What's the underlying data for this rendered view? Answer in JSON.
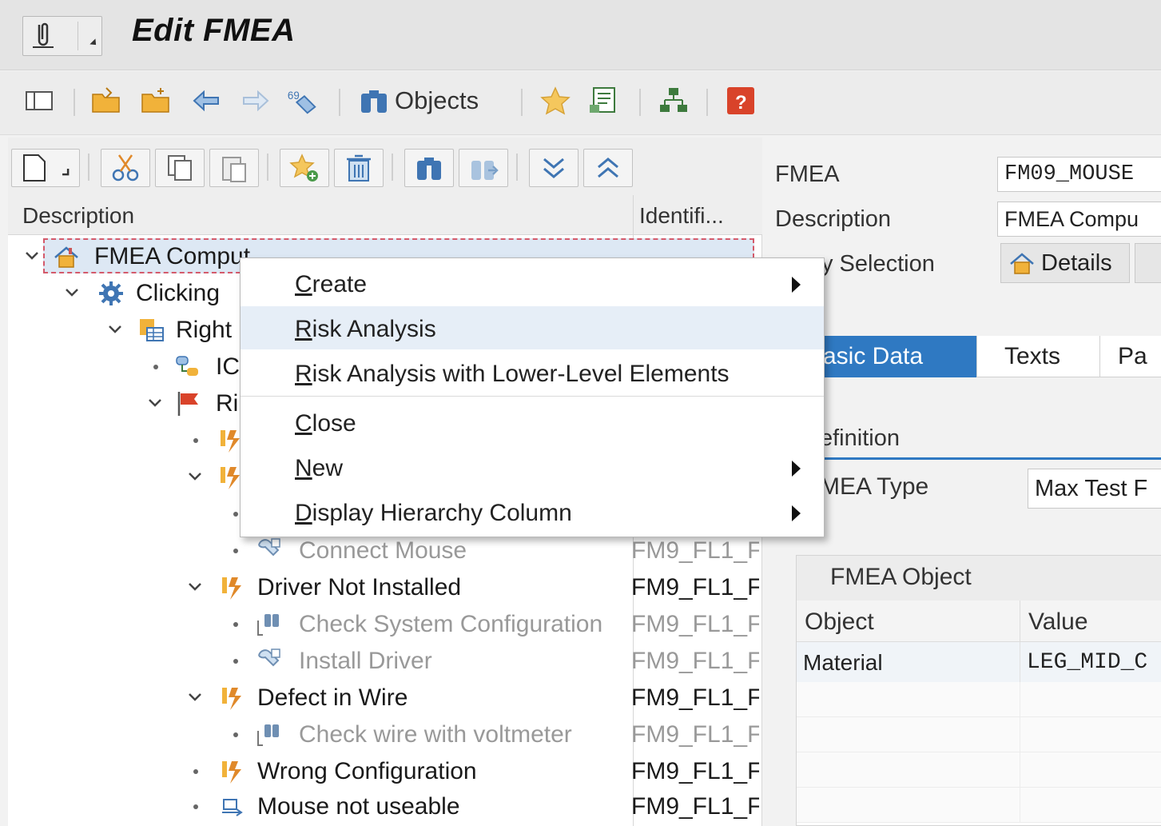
{
  "window": {
    "title": "Edit FMEA"
  },
  "toolbar": {
    "objects_label": "Objects"
  },
  "tree": {
    "columns": {
      "description": "Description",
      "identifier": "Identifi..."
    },
    "rows": [
      {
        "label": "FMEA Comput",
        "ident": ""
      },
      {
        "label": "Clicking",
        "ident": ""
      },
      {
        "label": "Right",
        "ident": ""
      },
      {
        "label": "IC",
        "ident": ""
      },
      {
        "label": "Ri",
        "ident": ""
      },
      {
        "label": "Connect Mouse",
        "ident": "FM9_FL1_F"
      },
      {
        "label": "Driver Not Installed",
        "ident": "FM9_FL1_F"
      },
      {
        "label": "Check System Configuration",
        "ident": "FM9_FL1_F"
      },
      {
        "label": "Install Driver",
        "ident": "FM9_FL1_F"
      },
      {
        "label": "Defect in Wire",
        "ident": "FM9_FL1_F"
      },
      {
        "label": "Check wire with voltmeter",
        "ident": "FM9_FL1_F"
      },
      {
        "label": "Wrong Configuration",
        "ident": "FM9_FL1_F"
      },
      {
        "label": "Mouse not useable",
        "ident": "FM9_FL1_F"
      }
    ]
  },
  "context_menu": {
    "items": [
      {
        "label_prefix": "",
        "label_key": "C",
        "label_rest": "reate",
        "submenu": true
      },
      {
        "label_prefix": "",
        "label_key": "R",
        "label_rest": "isk Analysis",
        "submenu": false
      },
      {
        "label_prefix": "",
        "label_key": "R",
        "label_rest": "isk Analysis with Lower-Level Elements",
        "submenu": false
      },
      {
        "label_prefix": "",
        "label_key": "C",
        "label_rest": "lose",
        "submenu": false
      },
      {
        "label_prefix": "",
        "label_key": "N",
        "label_rest": "ew",
        "submenu": true
      },
      {
        "label_prefix": "",
        "label_key": "D",
        "label_rest": "isplay Hierarchy Column",
        "submenu": true
      }
    ]
  },
  "detail": {
    "fmea_label": "FMEA",
    "fmea_value": "FM09_MOUSE",
    "description_label": "Description",
    "description_value": "FMEA Compu",
    "selection_label": "y Selection",
    "details_button": "Details",
    "tabs": [
      "asic Data",
      "Texts",
      "Pa"
    ],
    "section_title": "efinition",
    "fmea_type_label": "MEA Type",
    "fmea_type_value": "Max Test F",
    "object_table": {
      "title": "FMEA Object",
      "headers": [
        "Object",
        "Value"
      ],
      "rows": [
        [
          "Material",
          "LEG_MID_C"
        ]
      ]
    }
  },
  "colors": {
    "accent": "#2f79c2",
    "menu_highlight": "#e6eef7",
    "selection_border": "#d45a6b"
  }
}
